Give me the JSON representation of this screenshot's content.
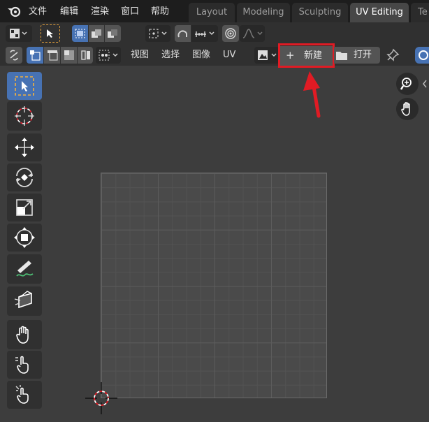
{
  "menubar": {
    "items": [
      "文件",
      "编辑",
      "渲染",
      "窗口",
      "帮助"
    ],
    "workspaces": [
      {
        "label": "Layout",
        "active": false
      },
      {
        "label": "Modeling",
        "active": false
      },
      {
        "label": "Sculpting",
        "active": false
      },
      {
        "label": "UV Editing",
        "active": true
      },
      {
        "label": "Te",
        "active": false
      }
    ]
  },
  "header": {
    "menus": [
      "视图",
      "选择",
      "图像",
      "UV"
    ],
    "new_label": "新建",
    "new_prefix": "+",
    "open_label": "打开"
  },
  "colors": {
    "accent": "#4772b3",
    "highlight": "#e01b24",
    "background": "#3d3d3d"
  },
  "toolbar": {
    "tools": [
      "select-box-icon",
      "cursor-icon",
      "move-icon",
      "rotate-icon",
      "scale-icon",
      "transform-icon",
      "annotate-icon",
      "rip-region-icon",
      "grab-icon",
      "relax-icon",
      "pinch-icon"
    ]
  }
}
